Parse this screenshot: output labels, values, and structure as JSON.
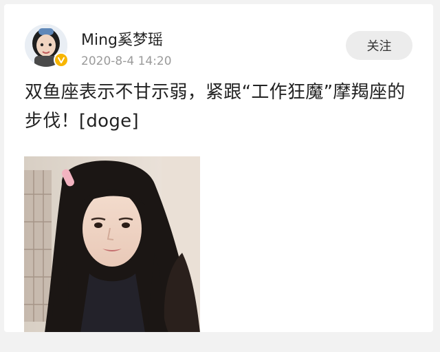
{
  "post": {
    "author_name": "Ming奚梦瑶",
    "timestamp": "2020-8-4 14:20",
    "follow_label": "关注",
    "text": "双鱼座表示不甘示弱，紧跟“工作狂魔”摩羯座的步伐！[doge]",
    "verified_badge": "verified-v-icon",
    "colors": {
      "badge": "#f7b500",
      "follow_bg": "#ececec",
      "text": "#222222",
      "meta": "#9a9a9a"
    }
  }
}
